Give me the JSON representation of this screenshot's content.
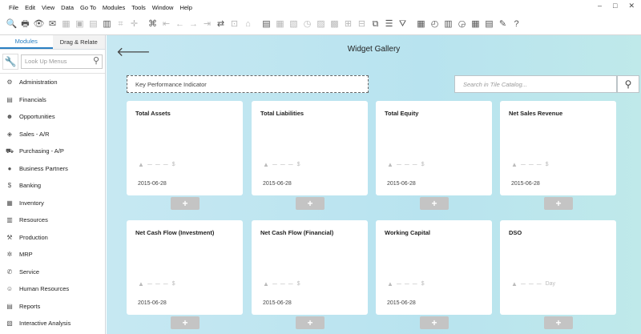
{
  "menu": [
    "File",
    "Edit",
    "View",
    "Data",
    "Go To",
    "Modules",
    "Tools",
    "Window",
    "Help"
  ],
  "window_controls": [
    "–",
    "□",
    "✕"
  ],
  "toolbar_icons": [
    "🔍",
    "🖶",
    "👁",
    "✉",
    "▦",
    "▣",
    "▤",
    "▥",
    "⌗",
    "✛",
    "⌘",
    "⇤",
    "←",
    "→",
    "⇥",
    "⇄",
    "⊡",
    "⌂",
    "▤",
    "▦",
    "▧",
    "◷",
    "▨",
    "▩",
    "⊞",
    "⊟",
    "⧉",
    "☰",
    "⛛",
    "▦",
    "◴",
    "▥",
    "◶",
    "▦",
    "▤",
    "✎",
    "?"
  ],
  "sidebar": {
    "tabs": [
      "Modules",
      "Drag & Relate"
    ],
    "lookup_placeholder": "Look Up Menus",
    "modules": [
      {
        "label": "Administration",
        "icon": "⚙"
      },
      {
        "label": "Financials",
        "icon": "▤"
      },
      {
        "label": "Opportunities",
        "icon": "☻"
      },
      {
        "label": "Sales - A/R",
        "icon": "◈"
      },
      {
        "label": "Purchasing - A/P",
        "icon": "⛟"
      },
      {
        "label": "Business Partners",
        "icon": "●"
      },
      {
        "label": "Banking",
        "icon": "$"
      },
      {
        "label": "Inventory",
        "icon": "▦"
      },
      {
        "label": "Resources",
        "icon": "▥"
      },
      {
        "label": "Production",
        "icon": "⚒"
      },
      {
        "label": "MRP",
        "icon": "✲"
      },
      {
        "label": "Service",
        "icon": "✆"
      },
      {
        "label": "Human Resources",
        "icon": "☺"
      },
      {
        "label": "Reports",
        "icon": "▤"
      },
      {
        "label": "Interactive Analysis",
        "icon": "▧"
      }
    ]
  },
  "main": {
    "title": "Widget Gallery",
    "kpi_label": "Key Performance Indicator",
    "search_placeholder": "Search in Tile Catalog...",
    "tiles": [
      {
        "title": "Total Assets",
        "unit": "$",
        "date": "2015-06-28"
      },
      {
        "title": "Total Liabilities",
        "unit": "$",
        "date": "2015-06-28"
      },
      {
        "title": "Total Equity",
        "unit": "$",
        "date": "2015-06-28"
      },
      {
        "title": "Net Sales Revenue",
        "unit": "$",
        "date": "2015-06-28"
      },
      {
        "title": "Net Cash Flow (Investment)",
        "unit": "$",
        "date": "2015-06-28"
      },
      {
        "title": "Net Cash Flow (Financial)",
        "unit": "$",
        "date": "2015-06-28"
      },
      {
        "title": "Working Capital",
        "unit": "$",
        "date": "2015-06-28"
      },
      {
        "title": "DSO",
        "unit": "Day",
        "date": ""
      }
    ],
    "trend_placeholder": "▲ ─ ─ ─",
    "add_label": "+"
  }
}
